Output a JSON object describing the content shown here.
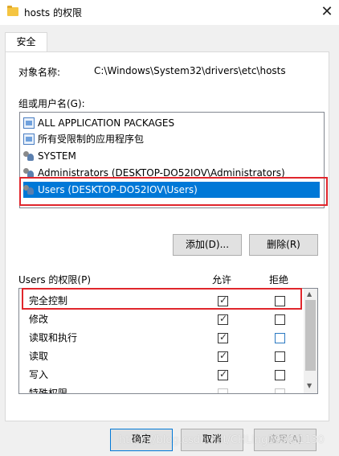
{
  "window": {
    "title": "hosts 的权限",
    "close_glyph": "✕"
  },
  "tabs": [
    {
      "label": "安全"
    }
  ],
  "object": {
    "label": "对象名称:",
    "value": "C:\\Windows\\System32\\drivers\\etc\\hosts"
  },
  "groups": {
    "label": "组或用户名(G):",
    "items": [
      {
        "label": "ALL APPLICATION PACKAGES",
        "icon": "package-icon"
      },
      {
        "label": "所有受限制的应用程序包",
        "icon": "package-icon"
      },
      {
        "label": "SYSTEM",
        "icon": "user-group-icon"
      },
      {
        "label": "Administrators (DESKTOP-DO52IOV\\Administrators)",
        "icon": "user-group-icon"
      },
      {
        "label": "Users (DESKTOP-DO52IOV\\Users)",
        "icon": "user-group-icon",
        "selected": true
      }
    ]
  },
  "buttons": {
    "add": "添加(D)...",
    "remove": "删除(R)",
    "ok": "确定",
    "cancel": "取消",
    "apply": "应用(A)"
  },
  "permissions": {
    "header": "Users 的权限(P)",
    "allow_label": "允许",
    "deny_label": "拒绝",
    "rows": [
      {
        "name": "完全控制",
        "allow": true,
        "deny": false
      },
      {
        "name": "修改",
        "allow": true,
        "deny": false
      },
      {
        "name": "读取和执行",
        "allow": true,
        "deny": false
      },
      {
        "name": "读取",
        "allow": true,
        "deny": false
      },
      {
        "name": "写入",
        "allow": true,
        "deny": false
      },
      {
        "name": "特殊权限",
        "allow": false,
        "deny": false
      }
    ]
  },
  "watermark": "https://blog.csdn.net/CHLing1996/1130",
  "colors": {
    "selection": "#0078d7",
    "highlight_box": "#e0262c"
  }
}
